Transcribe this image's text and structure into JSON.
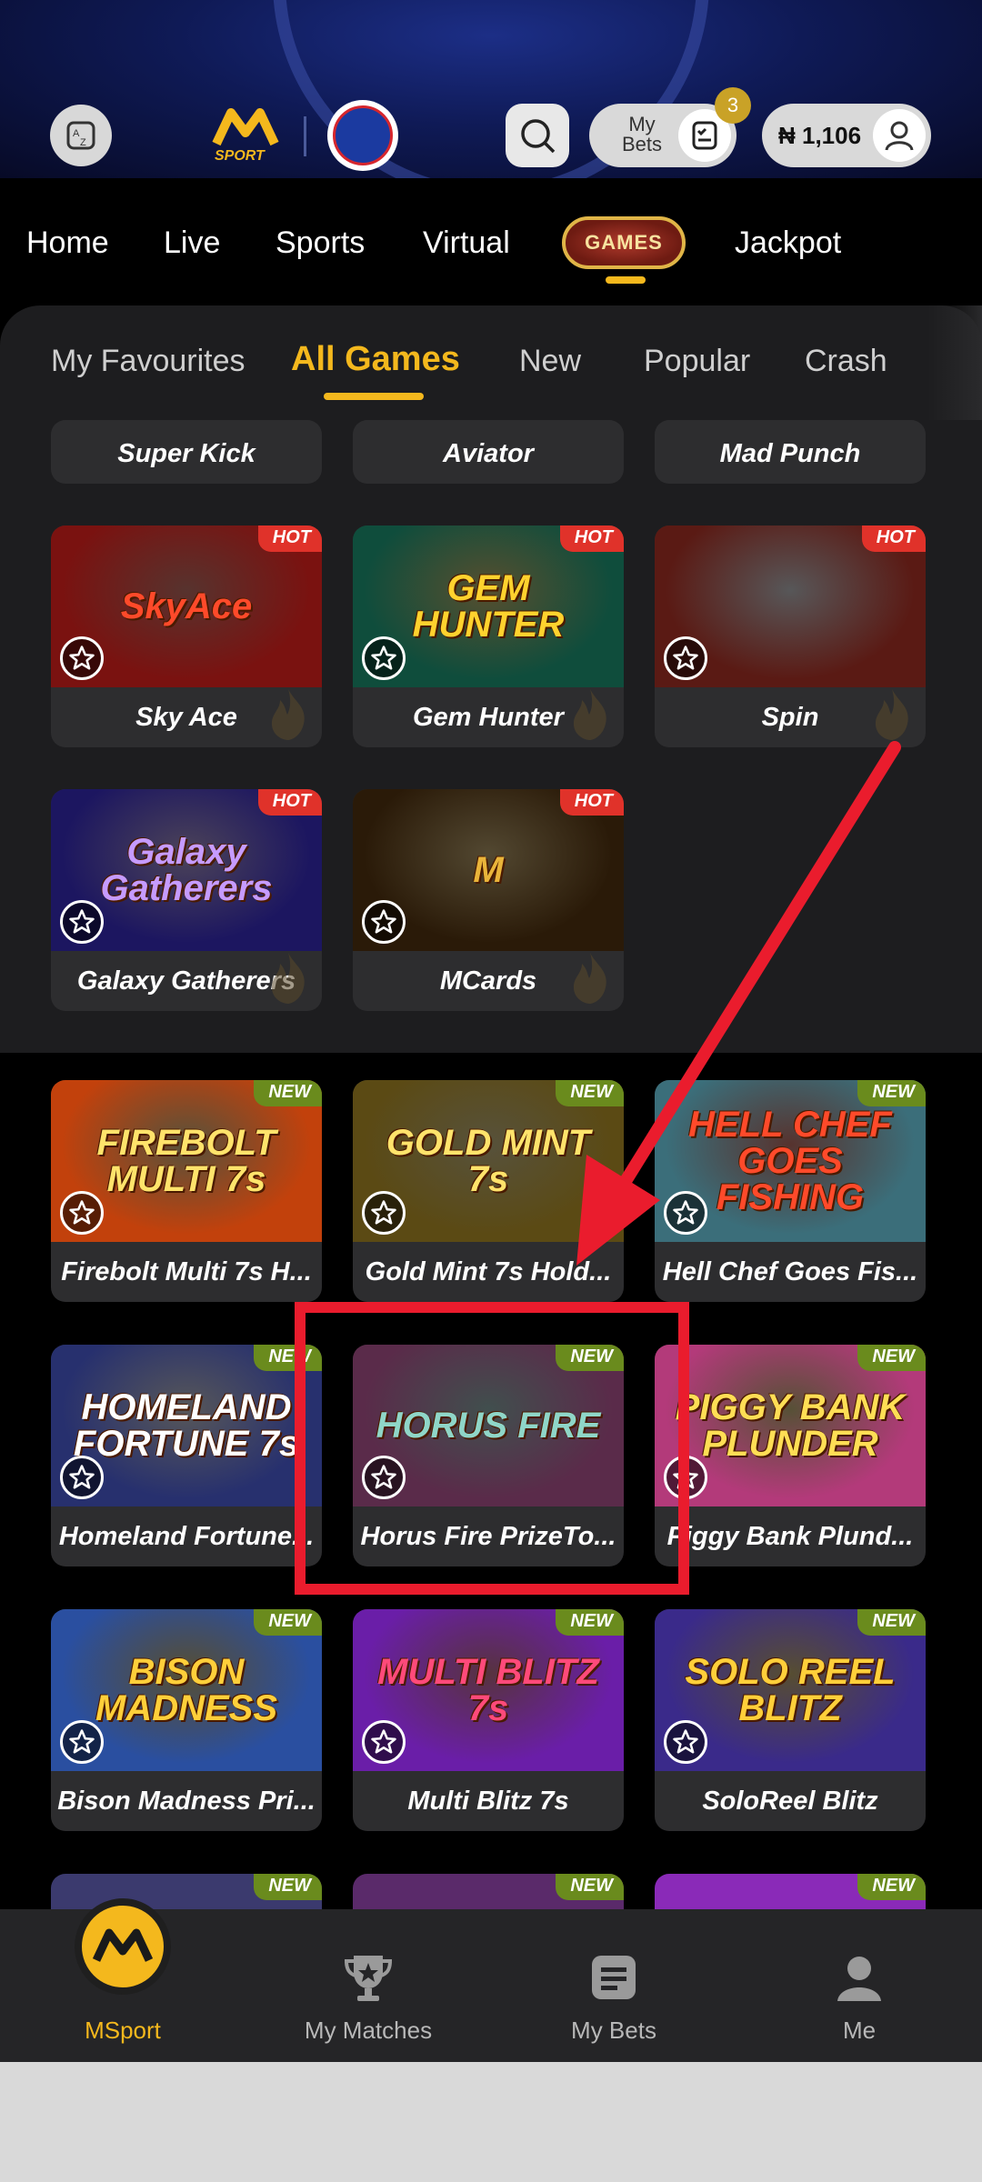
{
  "header": {
    "mybets_label_line1": "My",
    "mybets_label_line2": "Bets",
    "mybets_count": "3",
    "balance": "₦ 1,106",
    "icons": [
      "az-sort-icon",
      "msport-logo",
      "club-crest",
      "search-icon",
      "bets-list-icon",
      "user-icon"
    ]
  },
  "nav": {
    "items": [
      "Home",
      "Live",
      "Sports",
      "Virtual",
      "Jackpot"
    ],
    "games_label": "GAMES"
  },
  "subtabs": {
    "items": [
      "My Favourites",
      "All Games",
      "New",
      "Popular",
      "Crash"
    ],
    "active": "All Games"
  },
  "hot_section": {
    "tag": "HOT",
    "partial_row": [
      "Super Kick",
      "Aviator",
      "Mad Punch"
    ],
    "games": [
      {
        "name": "Sky Ace",
        "thumb_text": "SkyAce",
        "bg": "#7a1210",
        "fg": "#ff4a2a"
      },
      {
        "name": "Gem Hunter",
        "thumb_text": "GEM HUNTER",
        "bg": "#0f4d3c",
        "fg": "#ffd22e"
      },
      {
        "name": "Spin",
        "thumb_text": "",
        "bg": "#5a1a14",
        "fg": "#ffffff"
      },
      {
        "name": "Galaxy Gatherers",
        "thumb_text": "Galaxy Gatherers",
        "bg": "#1c1660",
        "fg": "#c69bff"
      },
      {
        "name": "MCards",
        "thumb_text": "M",
        "bg": "#2a1a08",
        "fg": "#e9b43a"
      }
    ]
  },
  "new_section": {
    "tag": "NEW",
    "games": [
      {
        "name": "Firebolt Multi 7s H...",
        "thumb_text": "FIREBOLT MULTI 7s",
        "bg": "#c2410c",
        "fg": "#ffe36b"
      },
      {
        "name": "Gold Mint 7s Hold...",
        "thumb_text": "GOLD MINT 7s",
        "bg": "#5b4a14",
        "fg": "#ffe36b"
      },
      {
        "name": "Hell Chef Goes Fis...",
        "thumb_text": "HELL CHEF GOES FISHING",
        "bg": "#3b6e7a",
        "fg": "#ff4a2a"
      },
      {
        "name": "Homeland Fortune...",
        "thumb_text": "HOMELAND FORTUNE 7s",
        "bg": "#27306e",
        "fg": "#ffffff"
      },
      {
        "name": "Horus Fire PrizeTo...",
        "thumb_text": "HORUS FIRE",
        "bg": "#5a2b4a",
        "fg": "#8fd6c8"
      },
      {
        "name": "Piggy Bank Plund...",
        "thumb_text": "PIGGY BANK PLUNDER",
        "bg": "#b33a7a",
        "fg": "#ffde55"
      },
      {
        "name": "Bison Madness Pri...",
        "thumb_text": "BISON MADNESS",
        "bg": "#2a4fa0",
        "fg": "#ffcf3a"
      },
      {
        "name": "Multi Blitz 7s",
        "thumb_text": "MULTI BLITZ 7s",
        "bg": "#6a1ea8",
        "fg": "#ff4a7a"
      },
      {
        "name": "SoloReel Blitz",
        "thumb_text": "SOLO REEL BLITZ",
        "bg": "#3a2a8a",
        "fg": "#ffcf3a"
      }
    ]
  },
  "bottom_nav": {
    "items": [
      "MSport",
      "My Matches",
      "My Bets",
      "Me"
    ],
    "active": "MSport"
  },
  "colors": {
    "accent": "#f4b81d",
    "hot_tag": "#e0322a",
    "new_tag": "#6a8b1d",
    "annotation": "#ea1c2d"
  }
}
